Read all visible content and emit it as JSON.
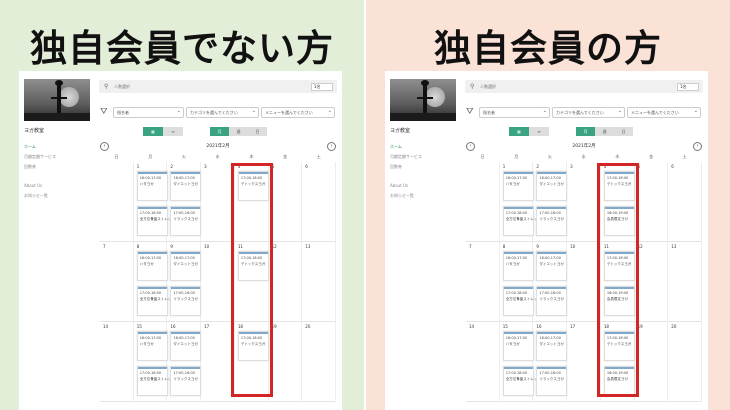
{
  "left_panel": {
    "headline": "独自会員でない方",
    "calendar": {
      "studio_name": "ヨガ教室",
      "nav": [
        "ホーム",
        "月額定額サービス",
        "回数券",
        "About Us",
        "お知らせ一覧"
      ],
      "search_placeholder": "人数選択",
      "people_select": "1名",
      "filters": [
        "指名者",
        "カテゴリを選んでください",
        "メニューを選んでください"
      ],
      "view_toggle": [
        "▦",
        "≡"
      ],
      "range_toggle": [
        "月",
        "週",
        "日"
      ],
      "month_title": "2021年2月",
      "prev": "‹",
      "next": "›",
      "weekdays": [
        "日",
        "月",
        "火",
        "水",
        "木",
        "金",
        "土"
      ],
      "weeks": [
        {
          "days": [
            "",
            "1",
            "2",
            "3",
            "4",
            "5",
            "6"
          ]
        },
        {
          "days": [
            "7",
            "8",
            "9",
            "10",
            "11",
            "12",
            "13"
          ]
        },
        {
          "days": [
            "14",
            "15",
            "16",
            "17",
            "18",
            "19",
            "20"
          ]
        }
      ],
      "events": {
        "mon": [
          {
            "time": "16:00-17:00",
            "name": "ハタヨガ"
          },
          {
            "time": "17:00-18:00",
            "name": "全方位骨盤ストレッチ"
          }
        ],
        "tue": [
          {
            "time": "16:00-17:00",
            "name": "ダイエットヨガ"
          },
          {
            "time": "17:00-18:00",
            "name": "リラックスヨガ"
          }
        ],
        "thu": [
          {
            "time": "17:00-18:00",
            "name": "デトックスヨガ"
          }
        ]
      }
    }
  },
  "right_panel": {
    "headline": "独自会員の方",
    "calendar": {
      "studio_name": "ヨガ教室",
      "nav": [
        "ホーム",
        "月額定額サービス",
        "回数券",
        "About Us",
        "お知らせ一覧"
      ],
      "search_placeholder": "人数選択",
      "people_select": "1名",
      "filters": [
        "指名者",
        "カテゴリを選んでください",
        "メニューを選んでください"
      ],
      "view_toggle": [
        "▦",
        "≡"
      ],
      "range_toggle": [
        "月",
        "週",
        "日"
      ],
      "month_title": "2021年2月",
      "prev": "‹",
      "next": "›",
      "weekdays": [
        "日",
        "月",
        "火",
        "水",
        "木",
        "金",
        "土"
      ],
      "weeks": [
        {
          "days": [
            "",
            "1",
            "2",
            "3",
            "4",
            "5",
            "6"
          ]
        },
        {
          "days": [
            "7",
            "8",
            "9",
            "10",
            "11",
            "12",
            "13"
          ]
        },
        {
          "days": [
            "14",
            "15",
            "16",
            "17",
            "18",
            "19",
            "20"
          ]
        }
      ],
      "events": {
        "mon": [
          {
            "time": "16:00-17:00",
            "name": "ハタヨガ"
          },
          {
            "time": "17:00-18:00",
            "name": "全方位骨盤ストレッチ"
          }
        ],
        "tue": [
          {
            "time": "16:00-17:00",
            "name": "ダイエットヨガ"
          },
          {
            "time": "17:00-18:00",
            "name": "リラックスヨガ"
          }
        ],
        "thu": [
          {
            "time": "17:00-18:00",
            "name": "デトックスヨガ"
          },
          {
            "time": "18:00-19:00",
            "name": "会員限定ヨガ"
          }
        ]
      }
    }
  },
  "colors": {
    "left_bg": "#e3eed8",
    "right_bg": "#fbe2d6",
    "highlight": "#d42525",
    "accent": "#3aa381"
  }
}
